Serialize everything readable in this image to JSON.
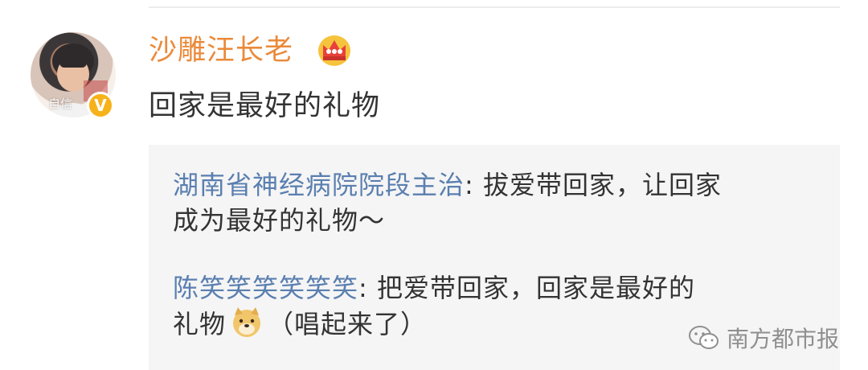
{
  "post": {
    "username": "沙雕汪长老",
    "avatar_caption": "自信",
    "verified_mark": "V",
    "content": "回家是最好的礼物"
  },
  "comments": [
    {
      "name": "湖南省神经病院院段主治",
      "separator": ": ",
      "line1": "拔爱带回家，让回家",
      "line2": "成为最好的礼物～"
    },
    {
      "name": "陈笑笑笑笑笑笑",
      "separator": ": ",
      "line1": "把爱带回家，回家是最好的",
      "line2_before": "礼物",
      "line2_after": "（唱起来了）",
      "emoji": "doge-icon"
    }
  ],
  "watermark": {
    "text": "南方都市报",
    "icon": "wechat-icon"
  },
  "colors": {
    "username": "#ea8a3a",
    "comment_name": "#5a7fb0",
    "body_text": "#333333",
    "verified_badge": "#f7b21a",
    "comment_bg": "#f5f5f5"
  }
}
